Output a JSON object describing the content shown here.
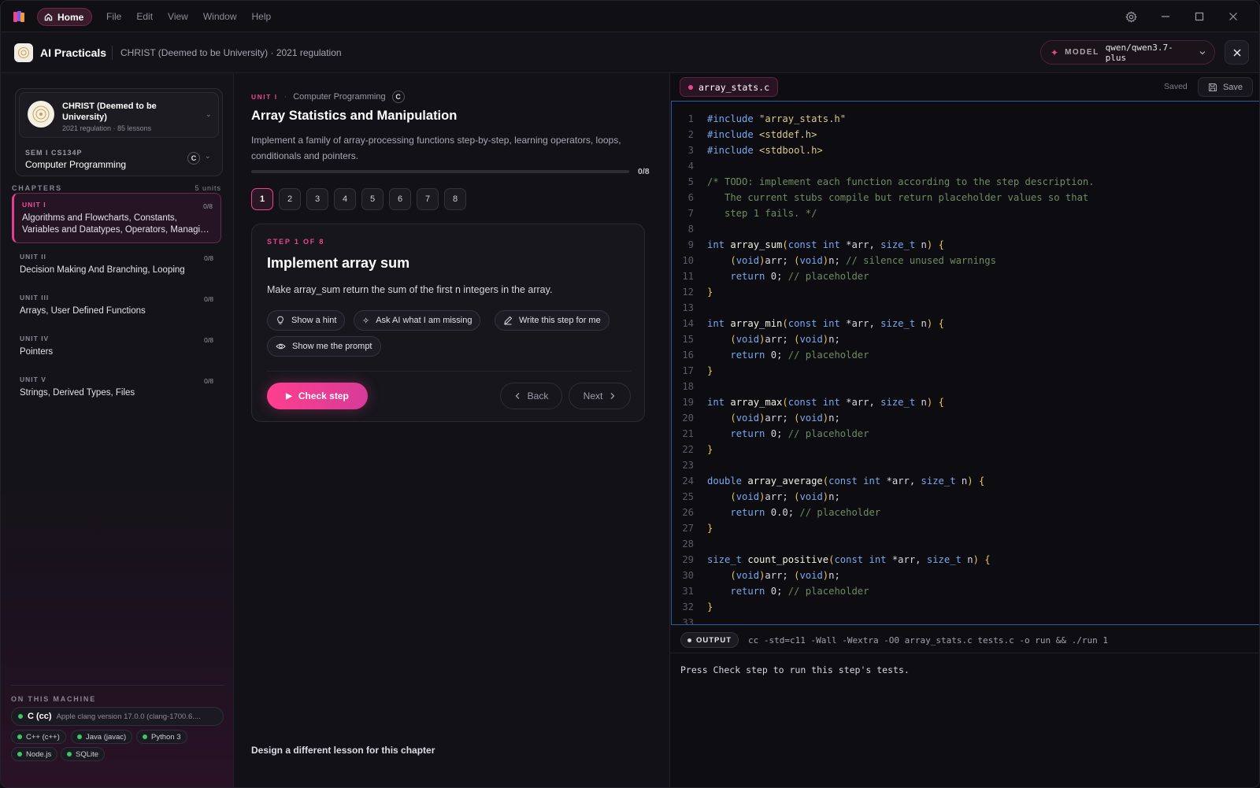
{
  "titlebar": {
    "home_label": "Home",
    "menu": [
      "File",
      "Edit",
      "View",
      "Window",
      "Help"
    ]
  },
  "header": {
    "title": "AI Practicals",
    "subtitle": "CHRIST (Deemed to be University) · 2021 regulation",
    "model_label": "MODEL",
    "model_value": "qwen/qwen3.7-plus"
  },
  "sidebar": {
    "school_name": "CHRIST (Deemed to be University)",
    "school_meta": "2021 regulation · 85 lessons",
    "semester_label": "SEM I  CS134P",
    "course_name": "Computer Programming",
    "course_lang": "C",
    "chapters_heading": "CHAPTERS",
    "chapters_count": "5 units",
    "chapters": [
      {
        "unit": "UNIT I",
        "count": "0/8",
        "title": "Algorithms and Flowcharts, Constants, Variables and Datatypes, Operators, Managi…"
      },
      {
        "unit": "UNIT II",
        "count": "0/8",
        "title": "Decision Making And Branching, Looping"
      },
      {
        "unit": "UNIT III",
        "count": "0/8",
        "title": "Arrays, User Defined Functions"
      },
      {
        "unit": "UNIT IV",
        "count": "0/8",
        "title": "Pointers"
      },
      {
        "unit": "UNIT V",
        "count": "0/8",
        "title": "Strings, Derived Types, Files"
      }
    ],
    "machine_heading": "ON THIS MACHINE",
    "machine_main_name": "C (cc)",
    "machine_main_version": "Apple clang version 17.0.0 (clang-1700.6....",
    "toolchains": [
      "C++ (c++)",
      "Java (javac)",
      "Python 3",
      "Node.js",
      "SQLite"
    ],
    "status_color": "#3fc46a"
  },
  "lesson": {
    "unit_tag": "UNIT I",
    "course": "Computer Programming",
    "lang": "C",
    "title": "Array Statistics and Manipulation",
    "description": "Implement a family of array-processing functions step-by-step, learning operators, loops, conditionals and pointers.",
    "progress_label": "0/8",
    "progress_fraction": 0,
    "steps": [
      "1",
      "2",
      "3",
      "4",
      "5",
      "6",
      "7",
      "8"
    ],
    "active_step": 0,
    "design_link": "Design a different lesson for this chapter"
  },
  "step": {
    "step_of": "STEP 1 OF 8",
    "title": "Implement array sum",
    "description": "Make array_sum return the sum of the first n integers in the array.",
    "actions": {
      "hint": "Show a hint",
      "ask_ai": "Ask AI what I am missing",
      "write": "Write this step for me",
      "prompt": "Show me the prompt"
    },
    "check_label": "Check step",
    "back_label": "Back",
    "next_label": "Next"
  },
  "editor": {
    "filename": "array_stats.c",
    "saved_label": "Saved",
    "save_label": "Save",
    "code_lines": [
      "#include \"array_stats.h\"",
      "#include <stddef.h>",
      "#include <stdbool.h>",
      "",
      "/* TODO: implement each function according to the step description.",
      "   The current stubs compile but return placeholder values so that",
      "   step 1 fails. */",
      "",
      "int array_sum(const int *arr, size_t n) {",
      "    (void)arr; (void)n; // silence unused warnings",
      "    return 0; // placeholder",
      "}",
      "",
      "int array_min(const int *arr, size_t n) {",
      "    (void)arr; (void)n;",
      "    return 0; // placeholder",
      "}",
      "",
      "int array_max(const int *arr, size_t n) {",
      "    (void)arr; (void)n;",
      "    return 0; // placeholder",
      "}",
      "",
      "double array_average(const int *arr, size_t n) {",
      "    (void)arr; (void)n;",
      "    return 0.0; // placeholder",
      "}",
      "",
      "size_t count_positive(const int *arr, size_t n) {",
      "    (void)arr; (void)n;",
      "    return 0; // placeholder",
      "}",
      ""
    ],
    "output_label": "OUTPUT",
    "output_command": "cc -std=c11 -Wall -Wextra -O0 array_stats.c tests.c -o run && ./run 1",
    "output_text": "Press Check step to run this step's tests."
  }
}
